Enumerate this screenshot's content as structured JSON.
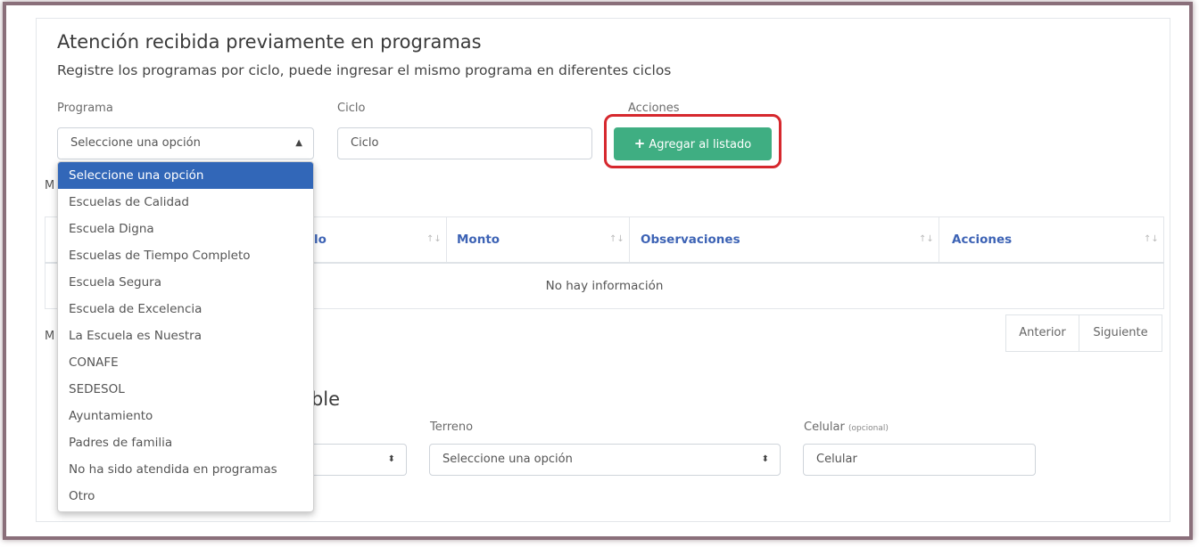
{
  "section1": {
    "title": "Atención recibida previamente en programas",
    "subtitle": "Registre los programas por ciclo, puede ingresar el mismo programa en diferentes ciclos"
  },
  "form": {
    "programa_label": "Programa",
    "programa_value": "Seleccione una opción",
    "ciclo_label": "Ciclo",
    "ciclo_placeholder": "Ciclo",
    "acciones_label": "Acciones",
    "add_button": "Agregar al listado"
  },
  "dropdown": {
    "options": [
      "Seleccione una opción",
      "Escuelas de Calidad",
      "Escuela Digna",
      "Escuelas de Tiempo Completo",
      "Escuela Segura",
      "Escuela de Excelencia",
      "La Escuela es Nuestra",
      "CONAFE",
      "SEDESOL",
      "Ayuntamiento",
      "Padres de familia",
      "No ha sido atendida en programas",
      "Otro"
    ],
    "selected_index": 0
  },
  "table": {
    "columns": [
      "lo",
      "Monto",
      "Observaciones",
      "Acciones"
    ],
    "empty_text": "No hay información",
    "prev": "Anterior",
    "next": "Siguiente"
  },
  "partial": {
    "m1": "M",
    "m2": "M",
    "section2_title_fragment": "eble"
  },
  "form2": {
    "terreno_label": "Terreno",
    "terreno_value": "Seleccione una opción",
    "celular_label": "Celular",
    "celular_optional": "(opcional)",
    "celular_placeholder": "Celular"
  },
  "icons": {
    "sort": "sort-icon",
    "select_arrow": "updown-arrow-icon",
    "plus": "plus-icon"
  },
  "colors": {
    "accent": "#3fae82",
    "highlight": "#d6282e",
    "selected": "#3267b8",
    "header_text": "#3d63b5"
  }
}
